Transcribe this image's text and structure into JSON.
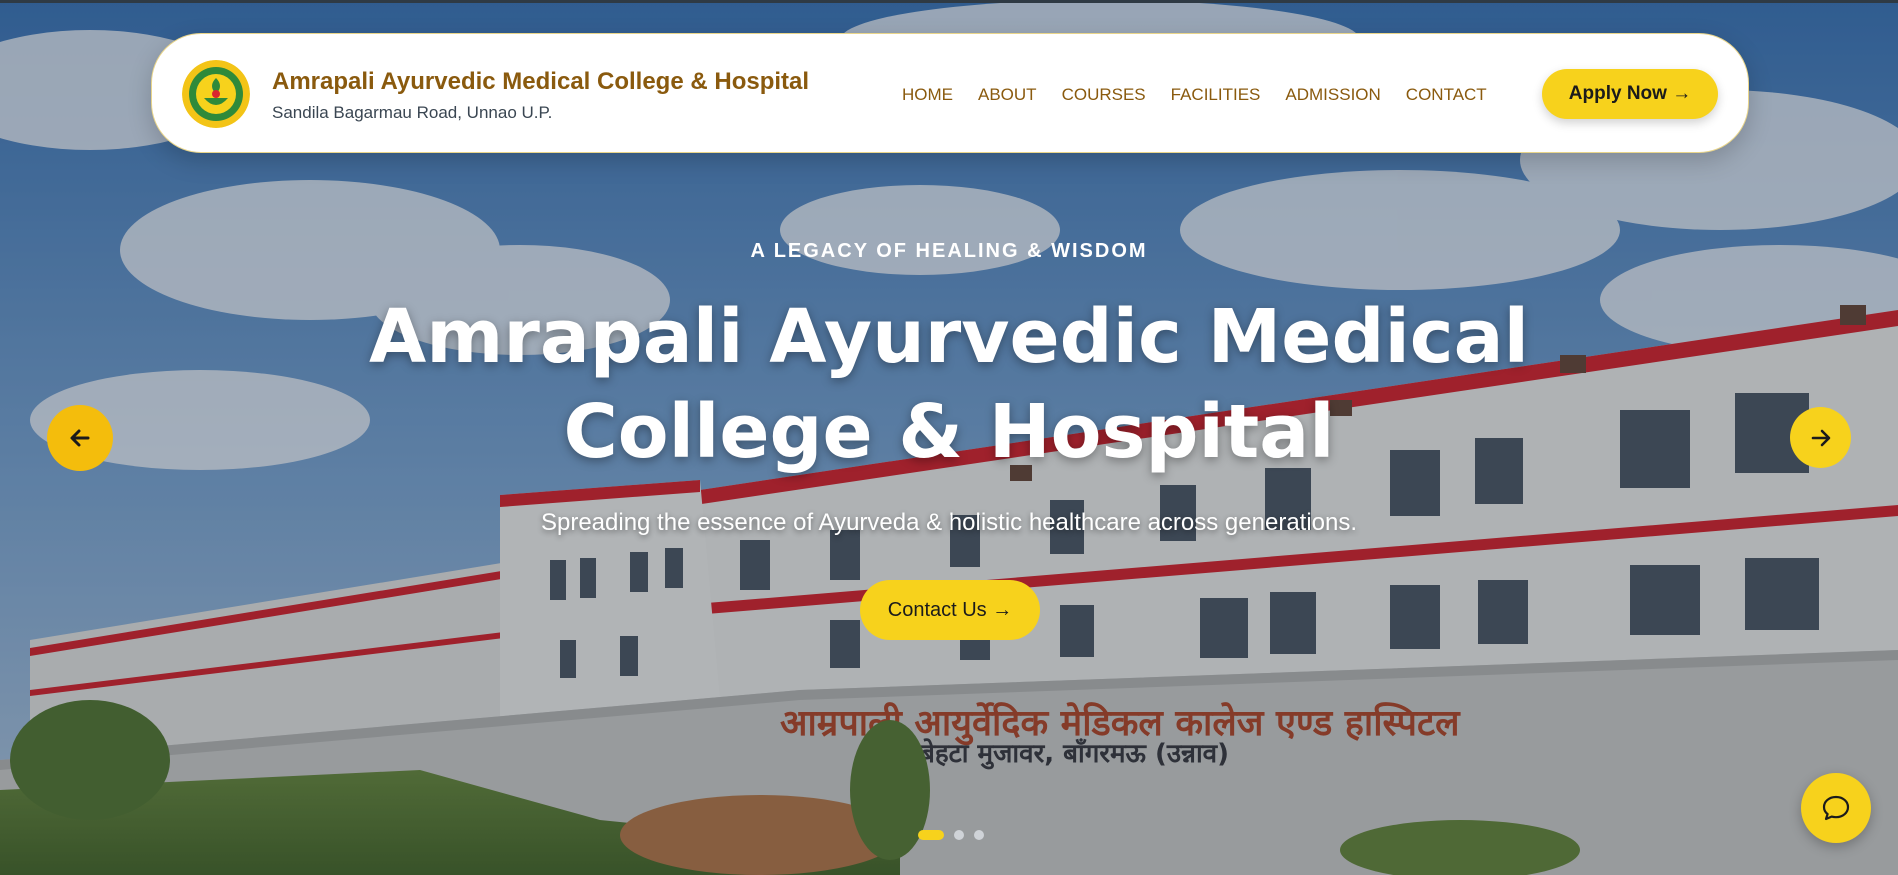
{
  "header": {
    "brand_title": "Amrapali Ayurvedic Medical College & Hospital",
    "brand_subtitle": "Sandila Bagarmau Road, Unnao U.P.",
    "nav": [
      "HOME",
      "ABOUT",
      "COURSES",
      "FACILITIES",
      "ADMISSION",
      "CONTACT"
    ],
    "apply_label": "Apply Now →"
  },
  "hero": {
    "eyebrow": "A LEGACY OF HEALING & WISDOM",
    "title": "Amrapali Ayurvedic Medical College & Hospital",
    "subtitle": "Spreading the essence of Ayurveda & holistic healthcare across generations.",
    "cta_label": "Contact Us →",
    "slide_count": 3,
    "active_slide": 1,
    "wall_signage": {
      "line1": "आम्रपाली आयुर्वेदिक मेडिकल कालेज एण्ड हास्पिटल",
      "line2": "बेहटा मुजावर, बाँगरमऊ (उन्नाव)"
    }
  },
  "icons": {
    "prev": "arrow-left-icon",
    "next": "arrow-right-icon",
    "chat": "chat-bubble-icon",
    "logo": "college-emblem-icon"
  },
  "colors": {
    "accent": "#f7d21c",
    "brand_text": "#8a5a0e",
    "building_trim": "#d9262e"
  }
}
